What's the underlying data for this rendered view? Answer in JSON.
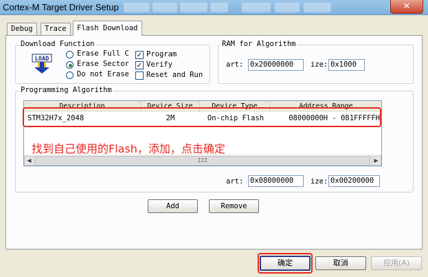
{
  "window": {
    "title": "Cortex-M Target Driver Setup",
    "close": "✕"
  },
  "tabs": [
    {
      "label": "Debug"
    },
    {
      "label": "Trace"
    },
    {
      "label": "Flash Download"
    }
  ],
  "download_function": {
    "title": "Download Function",
    "icon_label": "LOAD",
    "erase_options": [
      "Erase Full C",
      "Erase Sector",
      "Do not Erase"
    ],
    "selected_erase": "Erase Sector",
    "checks": [
      {
        "label": "Program",
        "checked": true
      },
      {
        "label": "Verify",
        "checked": true
      },
      {
        "label": "Reset and Run",
        "checked": false
      }
    ]
  },
  "ram": {
    "title": "RAM for Algorithm",
    "start_label": "art:",
    "start_value": "0x20000000",
    "size_label": "ize:",
    "size_value": "0x1000"
  },
  "programming": {
    "title": "Programming Algorithm",
    "columns": [
      "Description",
      "Device Size",
      "Device Type",
      "Address Range"
    ],
    "rows": [
      {
        "description": "STM32H7x_2048",
        "size": "2M",
        "type": "On-chip Flash",
        "range": "08000000H - 081FFFFFH"
      }
    ],
    "scroll_thumb": "III",
    "start_label": "art:",
    "start_value": "0x08000000",
    "size_label": "ize:",
    "size_value": "0x00200000",
    "add_label": "Add",
    "remove_label": "Remove"
  },
  "annotation": "找到自己使用的Flash，添加，点击确定",
  "footer": {
    "ok": "确定",
    "cancel": "取消",
    "apply": "应用(A)"
  }
}
